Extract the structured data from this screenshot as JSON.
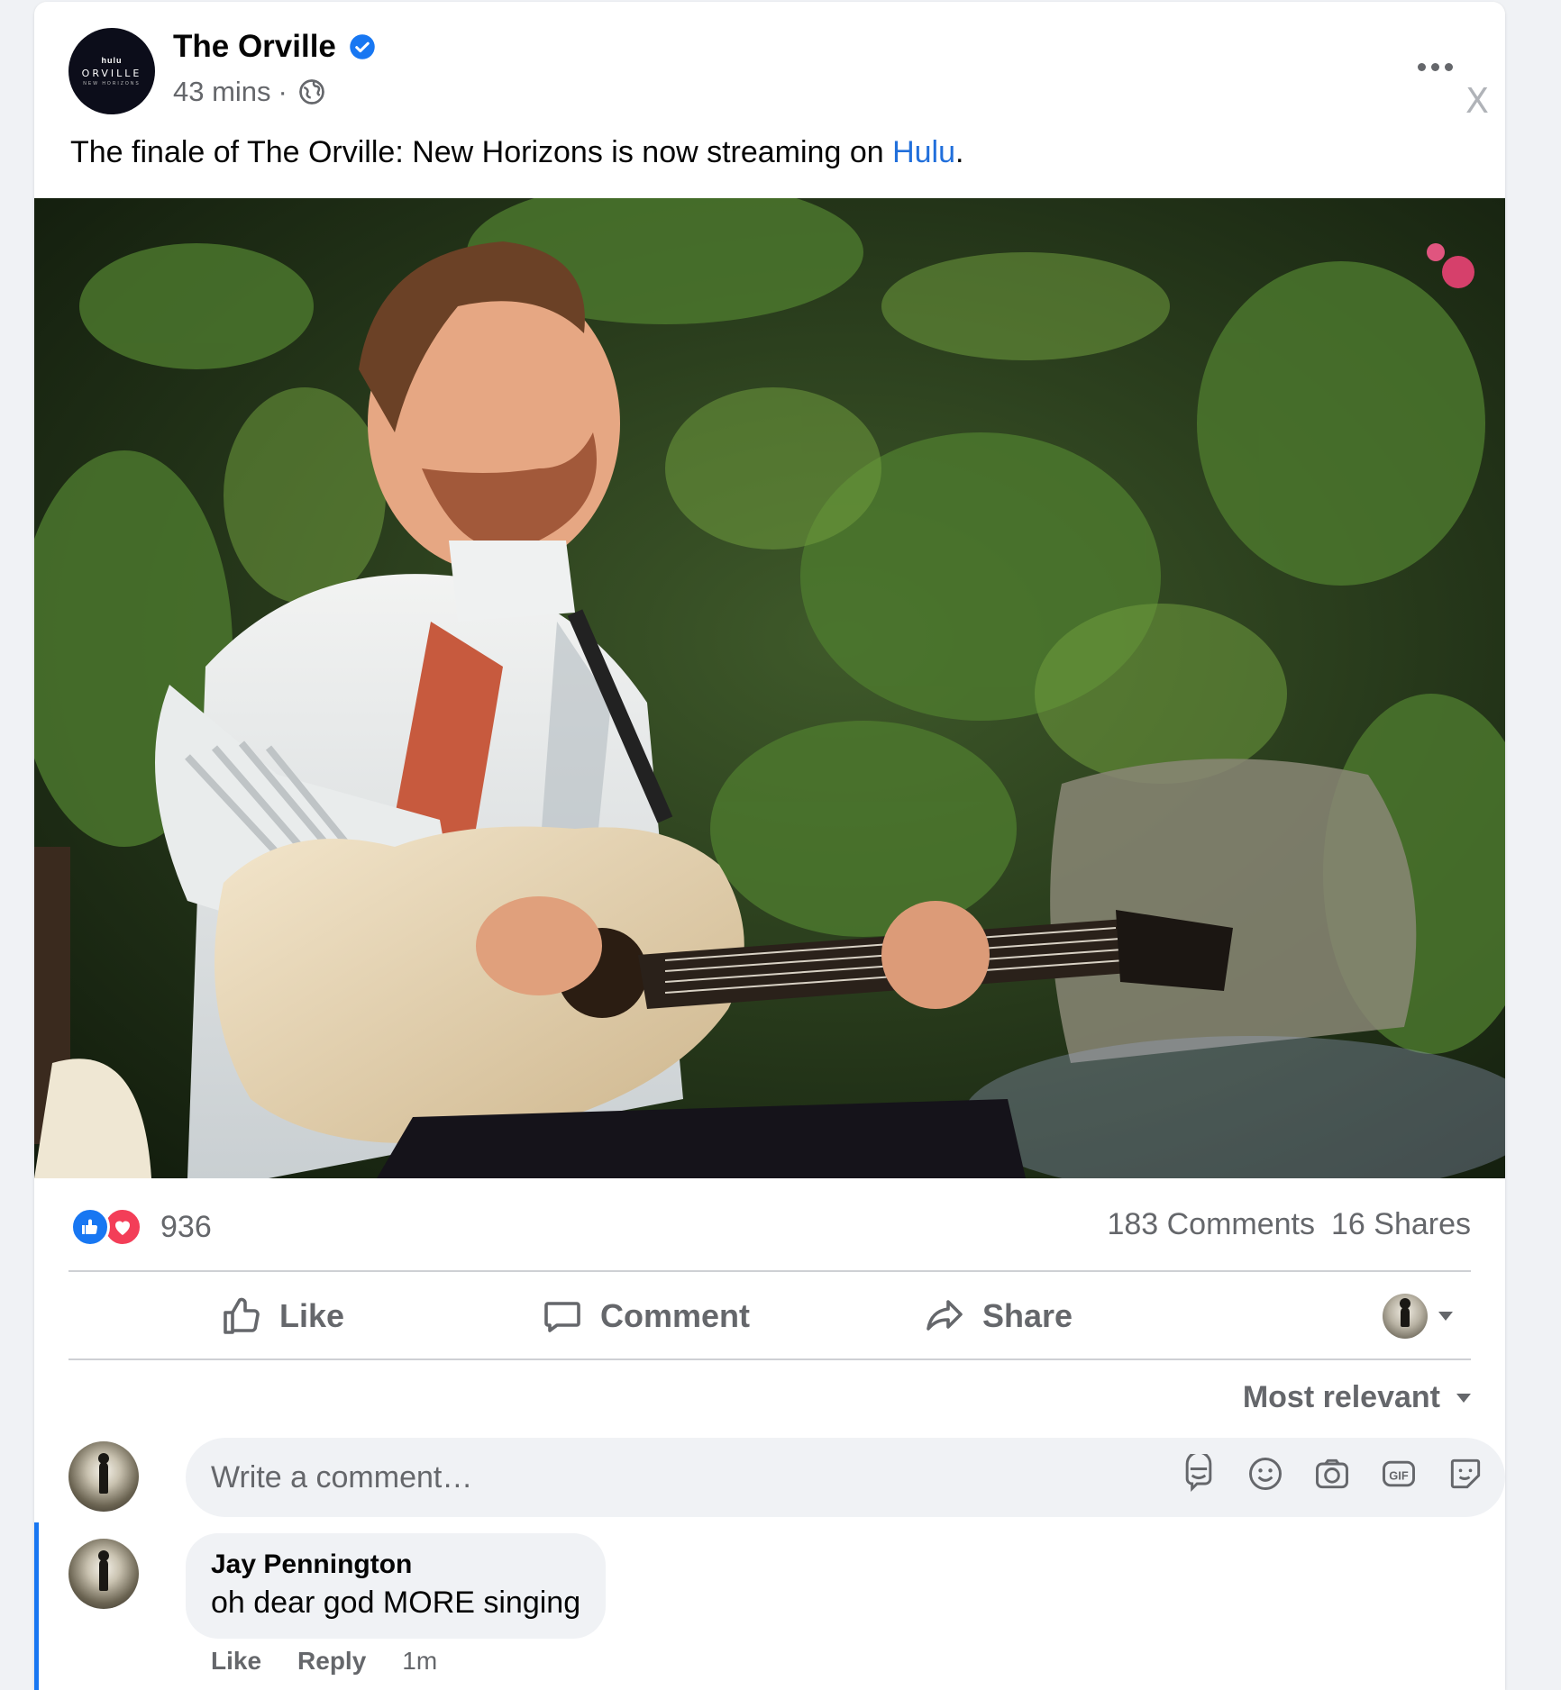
{
  "post": {
    "page_name": "The Orville",
    "avatar": {
      "brand_top": "hulu",
      "wordmark": "ORVILLE",
      "subtitle": "NEW HORIZONS"
    },
    "time": "43 mins",
    "separator": "·",
    "audience_icon": "globe-icon",
    "close_label": "X",
    "text_before_link": "The finale of The Orville: New Horizons is now streaming on ",
    "link_text": "Hulu",
    "text_after_link": "."
  },
  "stats": {
    "reaction_count": "936",
    "comments": "183 Comments",
    "shares": "16 Shares"
  },
  "actions": {
    "like": "Like",
    "comment": "Comment",
    "share": "Share"
  },
  "sort": {
    "label": "Most relevant"
  },
  "composer": {
    "placeholder": "Write a comment…",
    "icons": [
      "avatar-sticker-icon",
      "emoji-icon",
      "camera-icon",
      "gif-icon",
      "sticker-icon"
    ]
  },
  "comments": [
    {
      "author": "Jay Pennington",
      "text": "oh dear god MORE singing",
      "like": "Like",
      "reply": "Reply",
      "time": "1m"
    }
  ],
  "colors": {
    "link": "#216fdb",
    "like_blue": "#1877f2",
    "love_red": "#f33e58",
    "muted": "#65676b",
    "verified": "#1877f2"
  }
}
